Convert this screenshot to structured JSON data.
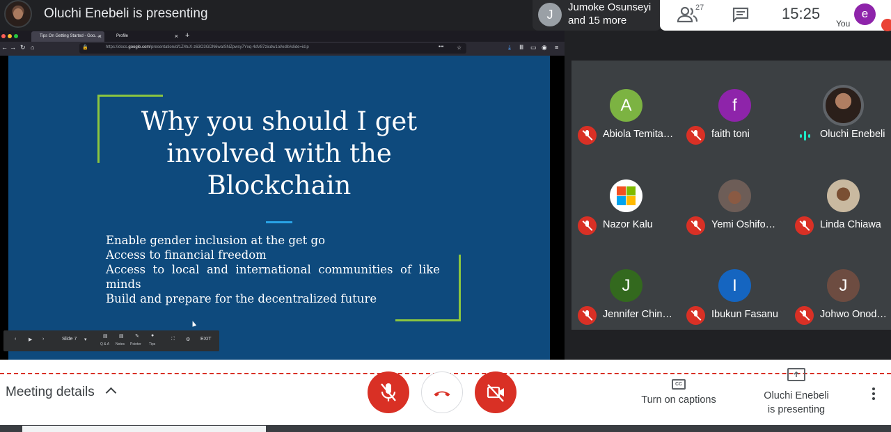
{
  "header": {
    "presenter_title": "Oluchi Enebeli is presenting",
    "people_avatar_letter": "J",
    "people_line1": "Jumoke Osunseyi",
    "people_line2": "and 15 more",
    "participant_count": "27",
    "clock": "15:25",
    "you_label": "You",
    "you_avatar_letter": "e"
  },
  "browser": {
    "tabs": [
      {
        "label": "Tips On Getting Started - Goo…"
      },
      {
        "label": "Profile"
      }
    ],
    "url_prefix": "https://docs.",
    "url_domain": "google.com",
    "url_path": "/presentation/d/1Z4tuX-z63O3GDN6waISNZpwsy7Yxq-4dV87zicdw1ol/edit#slide=id.p"
  },
  "slide": {
    "title_line1": "Why you should I get",
    "title_line2": "involved with the",
    "title_line3": "Blockchain",
    "bullets": [
      "Enable gender inclusion at the get go",
      "Access to financial freedom",
      "Access to local and international communities of like minds",
      "Build and prepare for the decentralized future"
    ]
  },
  "presenter_toolbar": {
    "slide_label": "Slide 7",
    "qa": "Q & A",
    "notes": "Notes",
    "pointer": "Pointer",
    "tips": "Tips",
    "exit": "EXIT"
  },
  "participants": [
    {
      "name": "Abiola Temita…",
      "avatar": "A",
      "color": "#7cb342",
      "muted": true
    },
    {
      "name": "faith toni",
      "avatar": "f",
      "color": "#8e24aa",
      "muted": true
    },
    {
      "name": "Oluchi Enebeli",
      "avatar": "",
      "color": "#5f6368",
      "muted": false
    },
    {
      "name": "Nazor Kalu",
      "avatar": "",
      "color": "#ffffff",
      "muted": true
    },
    {
      "name": "Yemi Oshifo…",
      "avatar": "",
      "color": "#6d5d57",
      "muted": true
    },
    {
      "name": "Linda Chiawa",
      "avatar": "",
      "color": "#9e8a6e",
      "muted": true
    },
    {
      "name": "Jennifer Chin…",
      "avatar": "J",
      "color": "#33691e",
      "muted": true
    },
    {
      "name": "Ibukun Fasanu",
      "avatar": "I",
      "color": "#1565c0",
      "muted": true
    },
    {
      "name": "Johwo Onod…",
      "avatar": "J",
      "color": "#6d4c41",
      "muted": true
    }
  ],
  "footer": {
    "meeting_details": "Meeting details",
    "captions_icon_text": "CC",
    "captions": "Turn on captions",
    "presenting_line1": "Oluchi Enebeli",
    "presenting_line2": "is presenting"
  },
  "colors": {
    "danger": "#d93025",
    "accent_green": "#8cc63f",
    "slide_bg": "#0e4a7d"
  }
}
